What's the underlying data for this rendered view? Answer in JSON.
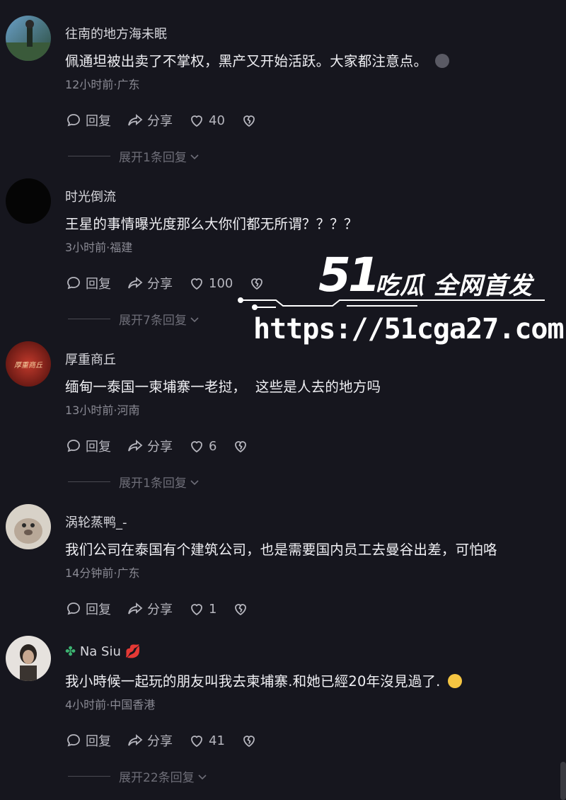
{
  "comments": [
    {
      "username": "往南的地方海未眠",
      "text": "佩通坦被出卖了不掌权，黑产又开始活跃。大家都注意点。",
      "meta": "12小时前·广东",
      "reply_label": "回复",
      "share_label": "分享",
      "likes": "40",
      "expand_label": "展开1条回复"
    },
    {
      "username": "时光倒流",
      "text": "王星的事情曝光度那么大你们都无所谓？？？？",
      "meta": "3小时前·福建",
      "reply_label": "回复",
      "share_label": "分享",
      "likes": "100",
      "expand_label": "展开7条回复"
    },
    {
      "username": "厚重商丘",
      "avatar_text": "厚重商丘",
      "text": "缅甸一泰国一柬埔寨一老挝，  这些是人去的地方吗",
      "meta": "13小时前·河南",
      "reply_label": "回复",
      "share_label": "分享",
      "likes": "6",
      "expand_label": "展开1条回复"
    },
    {
      "username": "涡轮蒸鸭_-",
      "text": "我们公司在泰国有个建筑公司，也是需要国内员工去曼谷出差，可怕咯",
      "meta": "14分钟前·广东",
      "reply_label": "回复",
      "share_label": "分享",
      "likes": "1"
    },
    {
      "username": "Na Siu",
      "text": "我小時候一起玩的朋友叫我去柬埔寨.和她已經20年沒見過了.",
      "meta": "4小时前·中国香港",
      "reply_label": "回复",
      "share_label": "分享",
      "likes": "41",
      "expand_label": "展开22条回复"
    }
  ],
  "watermark": {
    "number": "51",
    "title": "吃瓜 全网首发",
    "url": "https://51cga27.com"
  },
  "icons": {
    "reply": "comment-bubble-icon",
    "share": "share-arrow-icon",
    "like": "heart-icon",
    "dislike": "broken-heart-icon",
    "expand": "chevron-down-icon"
  },
  "colors": {
    "background": "#16161e",
    "text": "#f0f0f4",
    "muted": "#8a8a94"
  }
}
